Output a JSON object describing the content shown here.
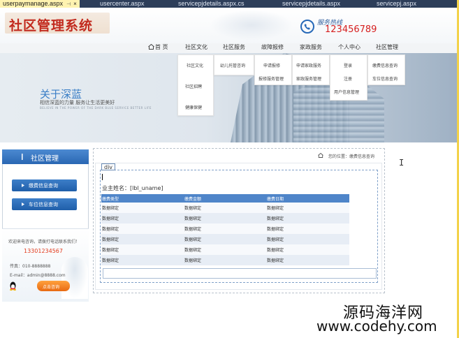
{
  "editor_tabs": [
    {
      "label": "userpaymanage.aspx",
      "active": true
    },
    {
      "label": "usercenter.aspx"
    },
    {
      "label": "servicepjdetails.aspx.cs"
    },
    {
      "label": "servicepjdetails.aspx"
    },
    {
      "label": "servicepj.aspx"
    }
  ],
  "header": {
    "logo_text": "社区管理系统",
    "hotline_label": "服务热线",
    "hotline_number": "123456789"
  },
  "nav": {
    "home": "首  页",
    "items": [
      "社区文化",
      "社区服务",
      "故障报修",
      "家政服务",
      "个人中心",
      "社区管理"
    ]
  },
  "dropdowns": {
    "col1": [
      "社区文化",
      "社区招聘",
      "健康保健"
    ],
    "col2": [
      "幼儿托管咨询"
    ],
    "col3": [
      "申请报修",
      "报修服务管理"
    ],
    "col4": [
      "申请家政服务",
      "家政服务管理"
    ],
    "col5": [
      "登录",
      "注册",
      "用户信息管理"
    ],
    "col6": [
      "缴费信息查询",
      "车位信息查询"
    ]
  },
  "banner": {
    "title": "关于深蓝",
    "subtitle": "相信深蓝的力量  服务让生活更美好",
    "tagline": "BELIEVE IN THE POWER OF THE DARK BLUE SERVICE BETTER LIFE"
  },
  "sidebar": {
    "title": "社区管理",
    "buttons": [
      "缴费信息查询",
      "车位信息查询"
    ],
    "contact_line": "欢迎来电咨询，请拨打电话联系我们！",
    "contact_phone": "13301234567",
    "tel": "传真：010-8888888",
    "email": "E-mail：admin@8888.com",
    "consult": "点击咨询"
  },
  "main": {
    "breadcrumb": "您的位置：缴费信息查询",
    "div_tag": "div",
    "owner_label": "业主姓名：[lbl_uname]",
    "table": {
      "headers": [
        "缴费类型",
        "缴费金额",
        "缴费日期"
      ],
      "rows": [
        [
          "数据绑定",
          "数据绑定",
          "数据绑定"
        ],
        [
          "数据绑定",
          "数据绑定",
          "数据绑定"
        ],
        [
          "数据绑定",
          "数据绑定",
          "数据绑定"
        ],
        [
          "数据绑定",
          "数据绑定",
          "数据绑定"
        ],
        [
          "数据绑定",
          "数据绑定",
          "数据绑定"
        ],
        [
          "数据绑定",
          "数据绑定",
          "数据绑定"
        ]
      ]
    }
  },
  "watermark": {
    "line1": "源码海洋网",
    "line2": "www.codehy.com"
  },
  "colors": {
    "brand_red": "#c22a1e",
    "nav_blue": "#2a67b3",
    "table_header": "#4f85c9",
    "consult_orange": "#e86a12"
  }
}
